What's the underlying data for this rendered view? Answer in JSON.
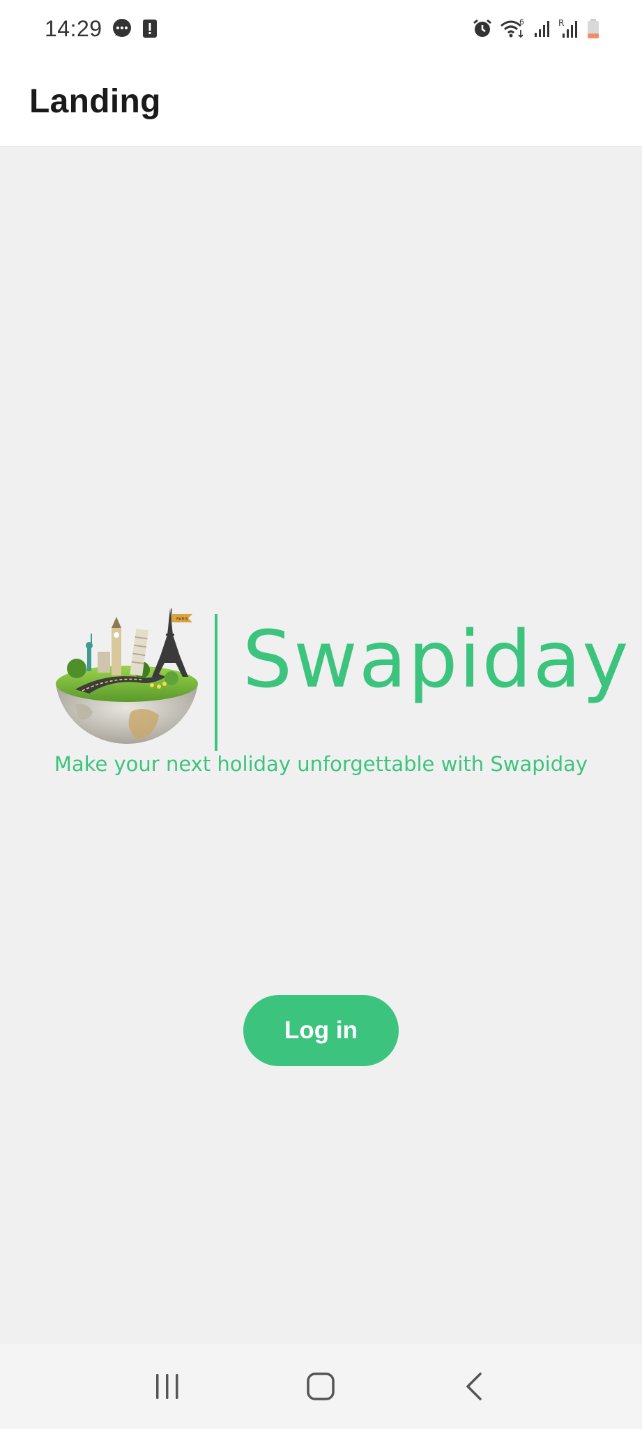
{
  "status_bar": {
    "time": "14:29",
    "left_icons": [
      "message-icon",
      "alert-icon"
    ],
    "right_icons": [
      "alarm-icon",
      "wifi-icon",
      "signal-icon",
      "roaming-signal-icon",
      "battery-icon"
    ],
    "wifi_label": "6",
    "roaming_label": "R",
    "battery_color": "#f28b6b"
  },
  "app_bar": {
    "title": "Landing"
  },
  "logo": {
    "brand_name": "Swapiday",
    "flag_text": "PARIS",
    "accent_color": "#3cc47e"
  },
  "tagline": "Make your next holiday unforgettable with Swapiday",
  "login_button": {
    "label": "Log in"
  },
  "nav_bar": {
    "buttons": [
      "recents-icon",
      "home-icon",
      "back-icon"
    ]
  }
}
